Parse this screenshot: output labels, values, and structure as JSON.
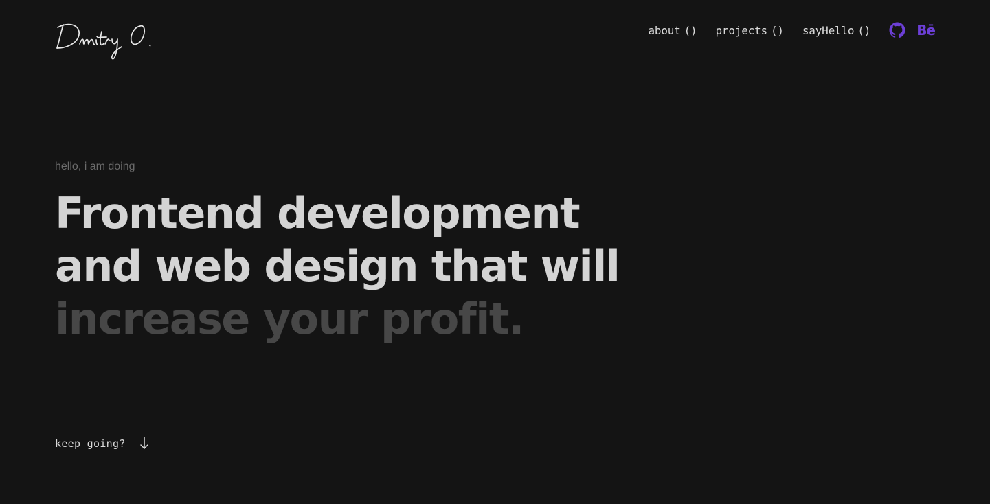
{
  "logo": {
    "text": "Dmitry O."
  },
  "nav": {
    "items": [
      {
        "label": "about",
        "parens": "()"
      },
      {
        "label": "projects",
        "parens": "()"
      },
      {
        "label": "sayHello",
        "parens": "()"
      }
    ],
    "icons": {
      "github": "github-icon",
      "behance": "Bē"
    }
  },
  "hero": {
    "eyebrow": "hello, i am doing",
    "lines": [
      "Frontend development",
      "and web design that will",
      "increase your profit."
    ]
  },
  "cta": {
    "label": "keep going?",
    "icon": "arrow-down-icon"
  },
  "colors": {
    "background": "#141414",
    "text": "#d4d4d4",
    "muted": "#474747",
    "accent": "#6c3fd6"
  }
}
